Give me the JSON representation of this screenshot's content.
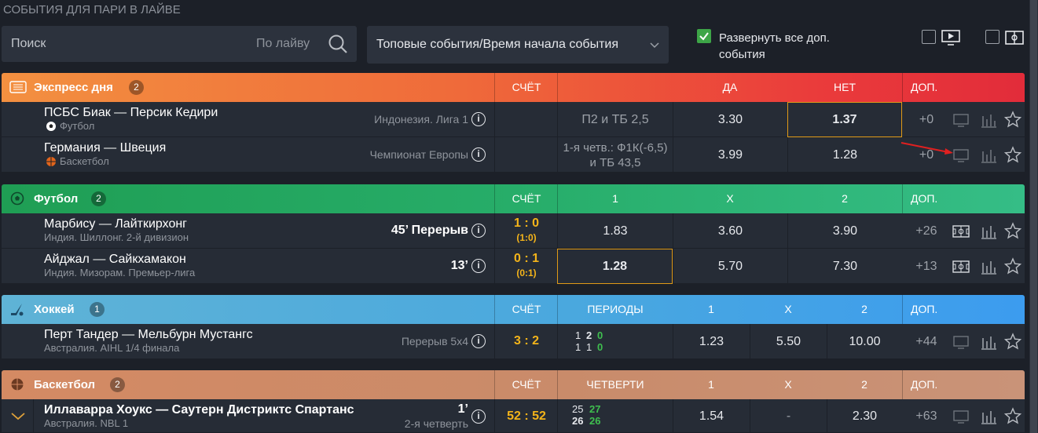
{
  "page_title": "СОБЫТИЯ ДЛЯ ПАРИ В ЛАЙВЕ",
  "search": {
    "placeholder": "Поиск",
    "scope": "По лайву"
  },
  "sort": {
    "value": "Топовые события/Время начала события"
  },
  "expand": {
    "label": "Развернуть все доп. события",
    "checked": true
  },
  "filters": [
    {
      "icon": "tv-icon",
      "checked": false
    },
    {
      "icon": "stats-icon",
      "checked": false
    }
  ],
  "sections": [
    {
      "name": "Экспресс дня",
      "count": "2",
      "cols": [
        "СЧЁТ",
        "ДА",
        "НЕТ",
        "ДОП."
      ],
      "color": "orange-red",
      "rows": [
        {
          "teams": "ПСБС Биак — Персик Кедири",
          "sport": "Футбол",
          "league": "Индонезия. Лига 1",
          "market": "П2 и ТБ 2,5",
          "odds": [
            "3.30",
            "1.37"
          ],
          "dop": "+0"
        },
        {
          "teams": "Германия — Швеция",
          "sport": "Баскетбол",
          "league": "Чемпионат Европы",
          "market": "1-я четв.: Ф1К(-6,5) и ТБ 43,5",
          "odds": [
            "3.99",
            "1.28"
          ],
          "dop": "+0"
        }
      ]
    },
    {
      "name": "Футбол",
      "count": "2",
      "cols": [
        "СЧЁТ",
        "1",
        "X",
        "2",
        "ДОП."
      ],
      "color": "green",
      "rows": [
        {
          "teams": "Марбису — Лайткирхонг",
          "league": "Индия. Шиллонг. 2-й дивизион",
          "time": "45’ Перерыв",
          "score": "1 : 0",
          "ht": "(1:0)",
          "odds": [
            "1.83",
            "3.60",
            "3.90"
          ],
          "dop": "+26"
        },
        {
          "teams": "Айджал — Сайкхамакон",
          "league": "Индия. Мизорам. Премьер-лига",
          "time": "13’",
          "score": "0 : 1",
          "ht": "(0:1)",
          "odds": [
            "1.28",
            "5.70",
            "7.30"
          ],
          "dop": "+13"
        }
      ]
    },
    {
      "name": "Хоккей",
      "count": "1",
      "cols": [
        "СЧЁТ",
        "ПЕРИОДЫ",
        "1",
        "X",
        "2",
        "ДОП."
      ],
      "color": "blue",
      "rows": [
        {
          "teams": "Перт Тандер — Мельбурн Мустангс",
          "league": "Австралия. AIHL 1/4 финала",
          "time": "Перерыв 5x4",
          "score": "3 : 2",
          "periods": [
            [
              "1",
              "2",
              "0"
            ],
            [
              "1",
              "1",
              "0"
            ]
          ],
          "odds": [
            "1.23",
            "5.50",
            "10.00"
          ],
          "dop": "+44"
        }
      ]
    },
    {
      "name": "Баскетбол",
      "count": "2",
      "cols": [
        "СЧЁТ",
        "ЧЕТВЕРТИ",
        "1",
        "X",
        "2",
        "ДОП."
      ],
      "color": "tan",
      "rows": [
        {
          "teams": "Иллаварра Хоукс — Саутерн Дистриктс Спартанс",
          "league": "Австралия. NBL 1",
          "time": "1’",
          "time2": "2-я четверть",
          "score": "52 : 52",
          "periods": [
            [
              "25",
              "27"
            ],
            [
              "26",
              "26"
            ]
          ],
          "odds": [
            "1.54",
            "-",
            "2.30"
          ],
          "dop": "+63"
        }
      ]
    }
  ]
}
